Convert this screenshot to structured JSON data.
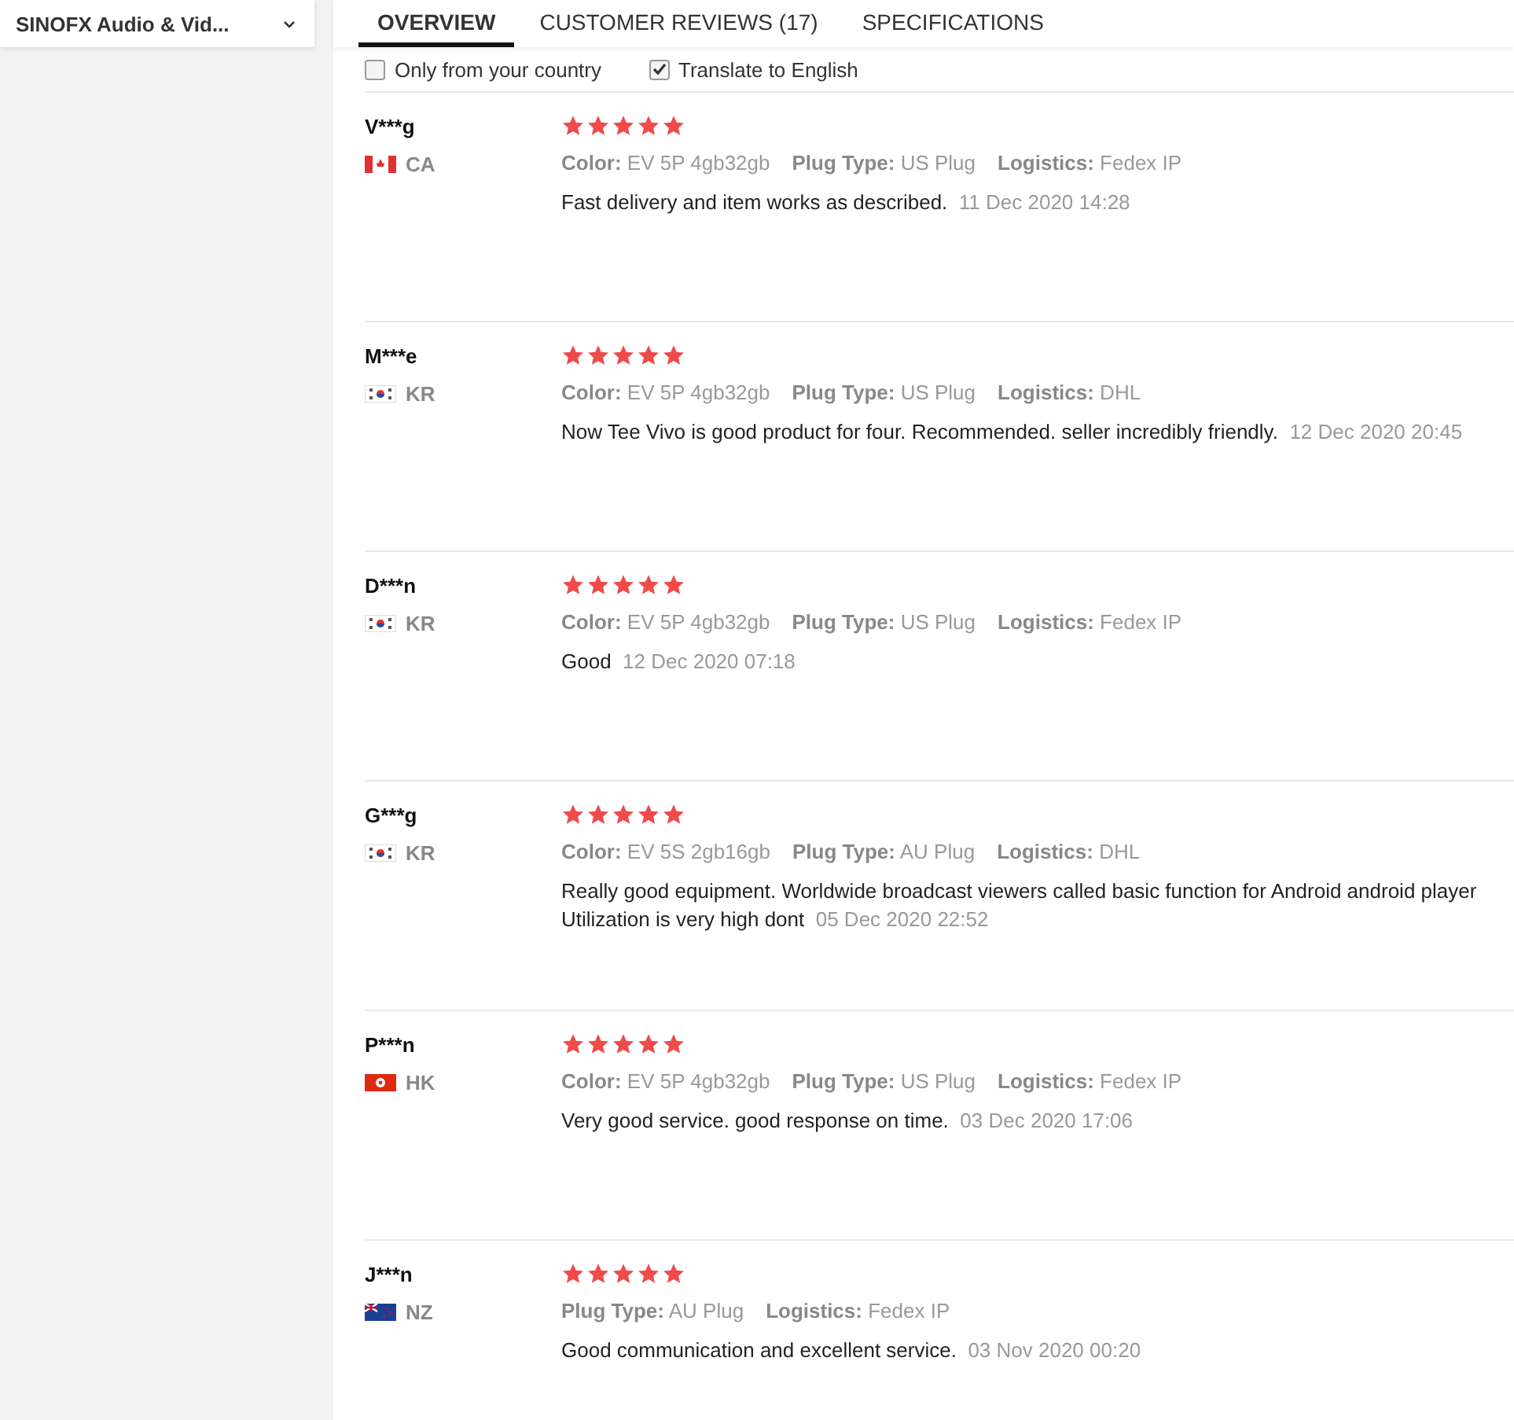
{
  "store": {
    "name": "SINOFX Audio & Vid..."
  },
  "tabs": [
    {
      "label": "OVERVIEW",
      "selected": true
    },
    {
      "label": "CUSTOMER REVIEWS (17)",
      "selected": false
    },
    {
      "label": "SPECIFICATIONS",
      "selected": false
    }
  ],
  "filters": [
    {
      "label": "Only from your country",
      "checked": false
    },
    {
      "label": "Translate to English",
      "checked": true
    }
  ],
  "reviews": [
    {
      "name": "V***g",
      "kind": "canada",
      "country": "CA",
      "stars": 5,
      "attributes": [
        {
          "label": "Color:",
          "value": "EV 5P 4gb32gb"
        },
        {
          "label": "Plug Type:",
          "value": "US Plug"
        },
        {
          "label": "Logistics:",
          "value": "Fedex IP"
        }
      ],
      "text": "Fast delivery and item works as described.",
      "date": "11 Dec 2020 14:28"
    },
    {
      "name": "M***e",
      "kind": "korea",
      "country": "KR",
      "stars": 5,
      "attributes": [
        {
          "label": "Color:",
          "value": "EV 5P 4gb32gb"
        },
        {
          "label": "Plug Type:",
          "value": "US Plug"
        },
        {
          "label": "Logistics:",
          "value": "DHL"
        }
      ],
      "text": "Now Tee Vivo is good product for four. Recommended. seller incredibly friendly.",
      "date": "12 Dec 2020 20:45"
    },
    {
      "name": "D***n",
      "kind": "korea",
      "country": "KR",
      "stars": 5,
      "attributes": [
        {
          "label": "Color:",
          "value": "EV 5P 4gb32gb"
        },
        {
          "label": "Plug Type:",
          "value": "US Plug"
        },
        {
          "label": "Logistics:",
          "value": "Fedex IP"
        }
      ],
      "text": "Good",
      "date": "12 Dec 2020 07:18"
    },
    {
      "name": "G***g",
      "kind": "korea",
      "country": "KR",
      "stars": 5,
      "attributes": [
        {
          "label": "Color:",
          "value": "EV 5S 2gb16gb"
        },
        {
          "label": "Plug Type:",
          "value": "AU Plug"
        },
        {
          "label": "Logistics:",
          "value": "DHL"
        }
      ],
      "text": "Really good equipment. Worldwide broadcast viewers called basic function for Android android player Utilization is very high dont",
      "date": "05 Dec 2020 22:52"
    },
    {
      "name": "P***n",
      "kind": "hongkong",
      "country": "HK",
      "stars": 5,
      "attributes": [
        {
          "label": "Color:",
          "value": "EV 5P 4gb32gb"
        },
        {
          "label": "Plug Type:",
          "value": "US Plug"
        },
        {
          "label": "Logistics:",
          "value": "Fedex IP"
        }
      ],
      "text": "Very good service. good response on time.",
      "date": "03 Dec 2020 17:06"
    },
    {
      "name": "J***n",
      "kind": "newzealand",
      "country": "NZ",
      "stars": 5,
      "attributes": [
        {
          "label": "Plug Type:",
          "value": "AU Plug"
        },
        {
          "label": "Logistics:",
          "value": "Fedex IP"
        }
      ],
      "text": "Good communication and excellent service.",
      "date": "03 Nov 2020 00:20"
    }
  ]
}
